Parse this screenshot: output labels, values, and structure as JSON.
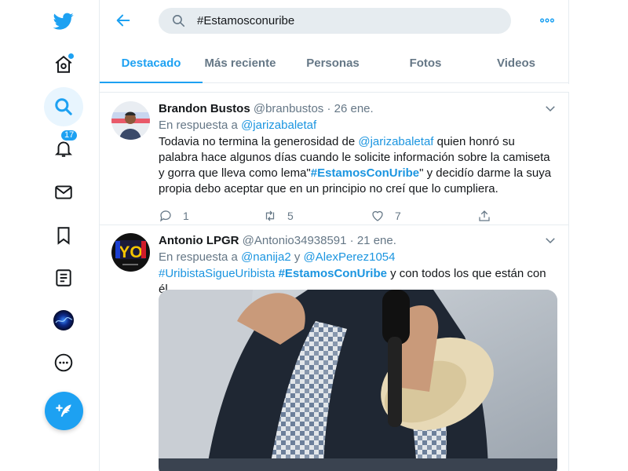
{
  "search": {
    "query": "#Estamosconuribe"
  },
  "nav": {
    "notifications_count": "17"
  },
  "tabs": [
    {
      "label": "Destacado"
    },
    {
      "label": "Más reciente"
    },
    {
      "label": "Personas"
    },
    {
      "label": "Fotos"
    },
    {
      "label": "Videos"
    }
  ],
  "tweets": [
    {
      "name": "Brandon Bustos",
      "handle": "@branbustos",
      "sep": " · ",
      "date": "26 ene.",
      "reply_prefix": "En respuesta a ",
      "reply_to": "@jarizabaletaf",
      "text_1": "Todavia no termina la generosidad de ",
      "mention": "@jarizabaletaf",
      "text_2": " quien honró su palabra hace  algunos días cuando le solicite información sobre la camiseta y gorra que lleva como lema\"",
      "hashtag": "#EstamosConUribe",
      "text_3": "\" y decidío darme la suya propia debo aceptar que en un principio no creí que lo cumpliera.",
      "replies": "1",
      "retweets": "5",
      "likes": "7"
    },
    {
      "name": "Antonio LPGR",
      "handle": "@Antonio34938591",
      "sep": " · ",
      "date": "21 ene.",
      "reply_prefix": "En respuesta a ",
      "reply_to_1": "@nanija2",
      "reply_and": " y ",
      "reply_to_2": "@AlexPerez1054",
      "hashtag_1": "#UribistaSigueUribista",
      "hashtag_2": "#EstamosConUribe",
      "text_end": " y con todos los que están con él",
      "avatar_text": "YO"
    }
  ],
  "colors": {
    "accent": "#1da1f2",
    "link": "#1b95e0",
    "muted": "#657786",
    "border": "#e6ecf0"
  }
}
